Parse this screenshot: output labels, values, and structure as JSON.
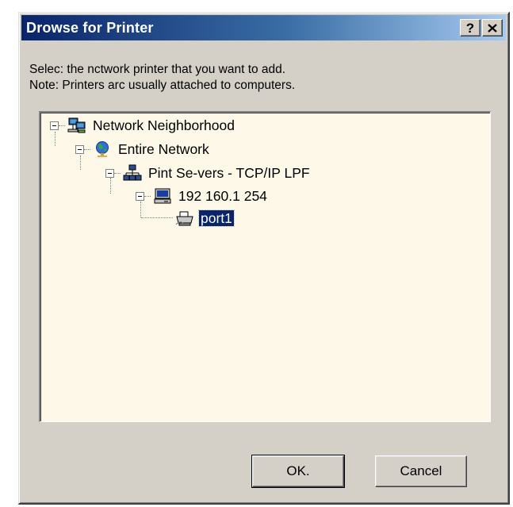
{
  "window": {
    "title": "Drowse for Printer",
    "help_button": "?",
    "close_button": "✕"
  },
  "instructions": {
    "line1": "Selec: the nctwork printer that you want to add.",
    "line2": "Note: Printers arc usually attached to computers."
  },
  "tree": {
    "items": [
      {
        "label": "Network Neighborhood",
        "icon": "network-neighborhood-icon",
        "expanded": true
      },
      {
        "label": "Entire Network",
        "icon": "globe-icon",
        "expanded": true
      },
      {
        "label": "Pint Se-vers - TCP/IP LPF",
        "icon": "print-servers-icon",
        "expanded": true
      },
      {
        "label": "192 160.1 254",
        "icon": "computer-icon",
        "expanded": true
      },
      {
        "label": "port1",
        "icon": "printer-icon",
        "selected": true
      }
    ]
  },
  "buttons": {
    "ok": "OK.",
    "cancel": "Cancel"
  },
  "colors": {
    "title_start": "#0a246a",
    "title_end": "#a6caf0",
    "selection": "#0a246a",
    "face": "#d4d0c8",
    "tree_bg": "#fdf8e8"
  }
}
